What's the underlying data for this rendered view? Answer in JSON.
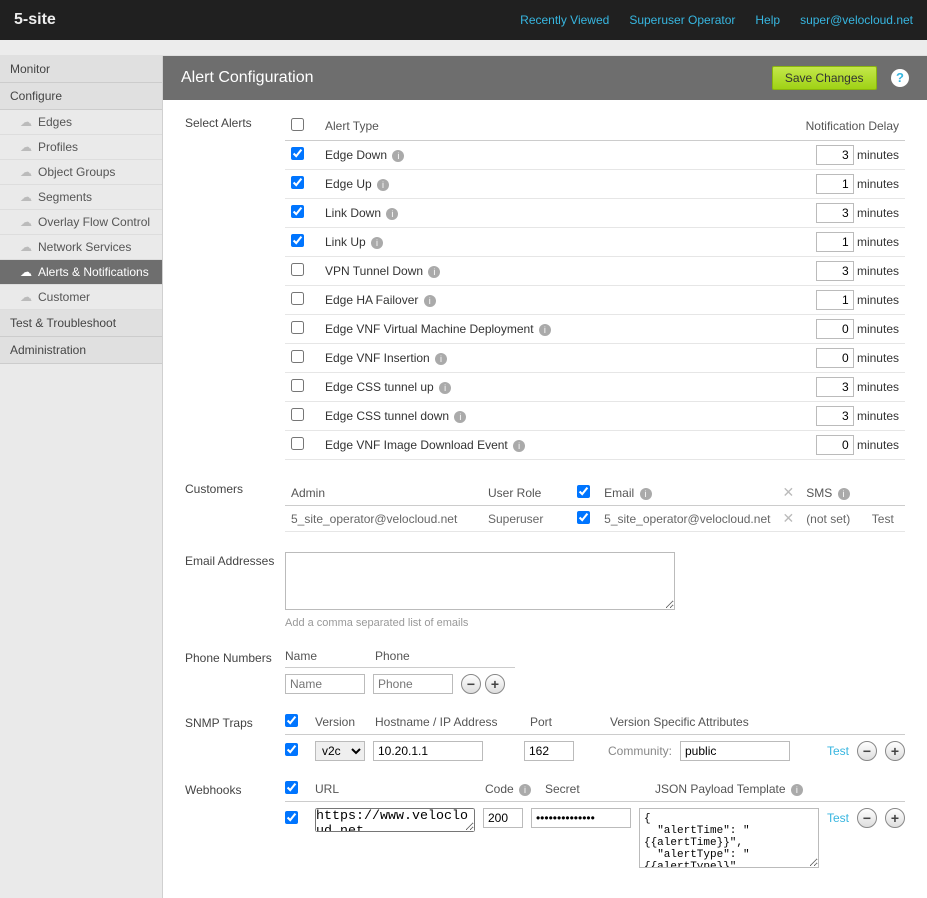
{
  "topbar": {
    "brand": "5-site",
    "links": {
      "recent": "Recently Viewed",
      "superuser": "Superuser Operator",
      "help": "Help",
      "user": "super@velocloud.net"
    }
  },
  "sidebar": {
    "monitor": "Monitor",
    "configure": "Configure",
    "configure_items": [
      "Edges",
      "Profiles",
      "Object Groups",
      "Segments",
      "Overlay Flow Control",
      "Network Services",
      "Alerts & Notifications",
      "Customer"
    ],
    "test": "Test & Troubleshoot",
    "admin": "Administration"
  },
  "page": {
    "title": "Alert Configuration",
    "save": "Save Changes"
  },
  "alerts_section": {
    "label": "Select Alerts",
    "col_type": "Alert Type",
    "col_delay": "Notification Delay",
    "unit": "minutes",
    "rows": [
      {
        "checked": true,
        "name": "Edge Down",
        "info": true,
        "delay": "3"
      },
      {
        "checked": true,
        "name": "Edge Up",
        "info": true,
        "delay": "1"
      },
      {
        "checked": true,
        "name": "Link Down",
        "info": true,
        "delay": "3"
      },
      {
        "checked": true,
        "name": "Link Up",
        "info": true,
        "delay": "1"
      },
      {
        "checked": false,
        "name": "VPN Tunnel Down",
        "info": true,
        "delay": "3"
      },
      {
        "checked": false,
        "name": "Edge HA Failover",
        "info": true,
        "delay": "1"
      },
      {
        "checked": false,
        "name": "Edge VNF Virtual Machine Deployment",
        "info": true,
        "delay": "0"
      },
      {
        "checked": false,
        "name": "Edge VNF Insertion",
        "info": true,
        "delay": "0"
      },
      {
        "checked": false,
        "name": "Edge CSS tunnel up",
        "info": true,
        "delay": "3"
      },
      {
        "checked": false,
        "name": "Edge CSS tunnel down",
        "info": true,
        "delay": "3"
      },
      {
        "checked": false,
        "name": "Edge VNF Image Download Event",
        "info": true,
        "delay": "0"
      }
    ]
  },
  "customers": {
    "label": "Customers",
    "cols": {
      "admin": "Admin",
      "role": "User Role",
      "email": "Email",
      "sms": "SMS"
    },
    "row": {
      "admin": "5_site_operator@velocloud.net",
      "role": "Superuser",
      "email_checked": true,
      "email": "5_site_operator@velocloud.net",
      "sms": "(not set)",
      "test": "Test"
    }
  },
  "emails": {
    "label": "Email Addresses",
    "hint": "Add a comma separated list of emails"
  },
  "phones": {
    "label": "Phone Numbers",
    "cols": {
      "name": "Name",
      "phone": "Phone"
    },
    "name_ph": "Name",
    "phone_ph": "Phone"
  },
  "snmp": {
    "label": "SNMP Traps",
    "col_version": "Version",
    "col_host": "Hostname / IP Address",
    "col_port": "Port",
    "col_attrs": "Version Specific Attributes",
    "row": {
      "version": "v2c",
      "host": "10.20.1.1",
      "port": "162",
      "community_label": "Community:",
      "community": "public",
      "test": "Test"
    }
  },
  "webhooks": {
    "label": "Webhooks",
    "col_url": "URL",
    "col_code": "Code",
    "col_secret": "Secret",
    "col_payload": "JSON Payload Template",
    "row": {
      "url": "https://www.velocloud.net",
      "code": "200",
      "secret": "••••••••••••••",
      "test": "Test",
      "payload": "{\n  \"alertTime\": \"{{alertTime}}\",\n  \"alertType\": \"{{alertType}}\",\n  \"customer\": \"{{customer}}\",\n  \"entityAffected\": \"{{entityAffected}}\","
    }
  },
  "icons": {
    "plus": "+",
    "minus": "−",
    "x": "✕",
    "info": "i",
    "help": "?"
  }
}
